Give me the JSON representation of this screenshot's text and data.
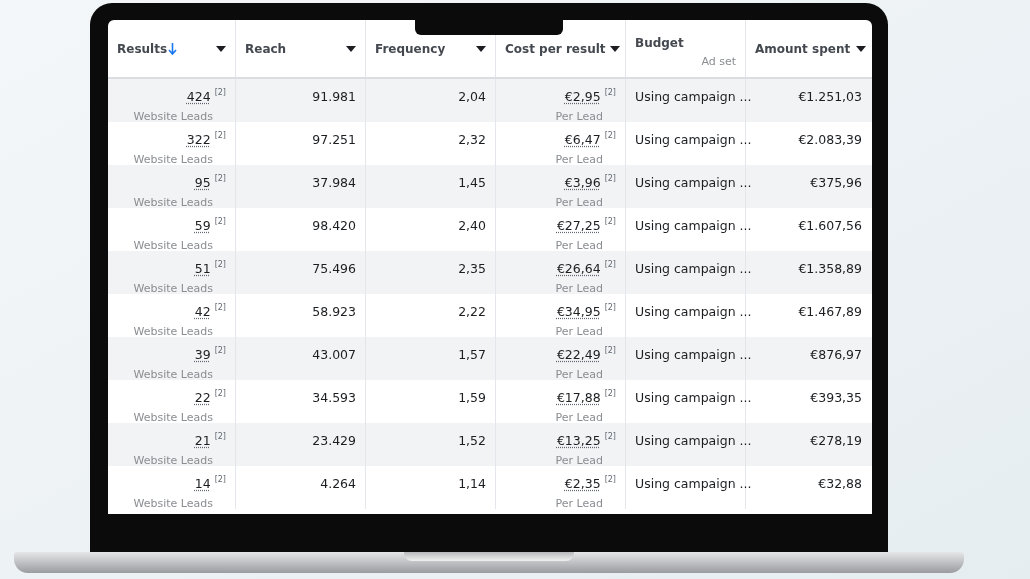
{
  "table": {
    "columns": [
      {
        "label": "Results",
        "sorted": true,
        "menu": true
      },
      {
        "label": "Reach",
        "sorted": false,
        "menu": true
      },
      {
        "label": "Frequency",
        "sorted": false,
        "menu": true
      },
      {
        "label": "Cost per result",
        "sorted": false,
        "menu": true
      },
      {
        "label": "Budget",
        "subtitle": "Ad set",
        "sorted": false,
        "menu": false
      },
      {
        "label": "Amount spent",
        "sorted": false,
        "menu": true
      }
    ],
    "rows": [
      {
        "results": "424",
        "results_note": "[2]",
        "results_unit": "Website Leads",
        "reach": "91.981",
        "frequency": "2,04",
        "cost": "€2,95",
        "cost_note": "[2]",
        "cost_unit": "Per Lead",
        "budget": "Using campaign ...",
        "spent": "€1.251,03"
      },
      {
        "results": "322",
        "results_note": "[2]",
        "results_unit": "Website Leads",
        "reach": "97.251",
        "frequency": "2,32",
        "cost": "€6,47",
        "cost_note": "[2]",
        "cost_unit": "Per Lead",
        "budget": "Using campaign ...",
        "spent": "€2.083,39"
      },
      {
        "results": "95",
        "results_note": "[2]",
        "results_unit": "Website Leads",
        "reach": "37.984",
        "frequency": "1,45",
        "cost": "€3,96",
        "cost_note": "[2]",
        "cost_unit": "Per Lead",
        "budget": "Using campaign ...",
        "spent": "€375,96"
      },
      {
        "results": "59",
        "results_note": "[2]",
        "results_unit": "Website Leads",
        "reach": "98.420",
        "frequency": "2,40",
        "cost": "€27,25",
        "cost_note": "[2]",
        "cost_unit": "Per Lead",
        "budget": "Using campaign ...",
        "spent": "€1.607,56"
      },
      {
        "results": "51",
        "results_note": "[2]",
        "results_unit": "Website Leads",
        "reach": "75.496",
        "frequency": "2,35",
        "cost": "€26,64",
        "cost_note": "[2]",
        "cost_unit": "Per Lead",
        "budget": "Using campaign ...",
        "spent": "€1.358,89"
      },
      {
        "results": "42",
        "results_note": "[2]",
        "results_unit": "Website Leads",
        "reach": "58.923",
        "frequency": "2,22",
        "cost": "€34,95",
        "cost_note": "[2]",
        "cost_unit": "Per Lead",
        "budget": "Using campaign ...",
        "spent": "€1.467,89"
      },
      {
        "results": "39",
        "results_note": "[2]",
        "results_unit": "Website Leads",
        "reach": "43.007",
        "frequency": "1,57",
        "cost": "€22,49",
        "cost_note": "[2]",
        "cost_unit": "Per Lead",
        "budget": "Using campaign ...",
        "spent": "€876,97"
      },
      {
        "results": "22",
        "results_note": "[2]",
        "results_unit": "Website Leads",
        "reach": "34.593",
        "frequency": "1,59",
        "cost": "€17,88",
        "cost_note": "[2]",
        "cost_unit": "Per Lead",
        "budget": "Using campaign ...",
        "spent": "€393,35"
      },
      {
        "results": "21",
        "results_note": "[2]",
        "results_unit": "Website Leads",
        "reach": "23.429",
        "frequency": "1,52",
        "cost": "€13,25",
        "cost_note": "[2]",
        "cost_unit": "Per Lead",
        "budget": "Using campaign ...",
        "spent": "€278,19"
      },
      {
        "results": "14",
        "results_note": "[2]",
        "results_unit": "Website Leads",
        "reach": "4.264",
        "frequency": "1,14",
        "cost": "€2,35",
        "cost_note": "[2]",
        "cost_unit": "Per Lead",
        "budget": "Using campaign ...",
        "spent": "€32,88"
      }
    ]
  }
}
